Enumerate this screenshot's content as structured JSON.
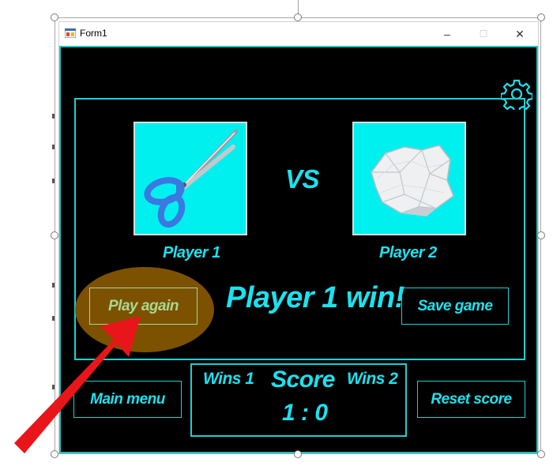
{
  "window": {
    "title": "Form1",
    "minimize_glyph": "–",
    "maximize_glyph": "☐",
    "close_glyph": "✕"
  },
  "game": {
    "vs_label": "VS",
    "player1": {
      "label": "Player 1",
      "choice": "scissors"
    },
    "player2": {
      "label": "Player 2",
      "choice": "paper"
    },
    "result_text": "Player 1 win!",
    "play_again_label": "Play again",
    "save_game_label": "Save game",
    "main_menu_label": "Main menu",
    "reset_score_label": "Reset score"
  },
  "score": {
    "title": "Score",
    "wins1_label": "Wins 1",
    "wins2_label": "Wins 2",
    "value": "1 : 0"
  },
  "colors": {
    "accent": "#19d2d2",
    "text": "#1be2ef",
    "highlight": "#8a5a00",
    "arrow": "#e8161a"
  },
  "icons": {
    "settings": "gear-icon",
    "app": "form-icon"
  }
}
